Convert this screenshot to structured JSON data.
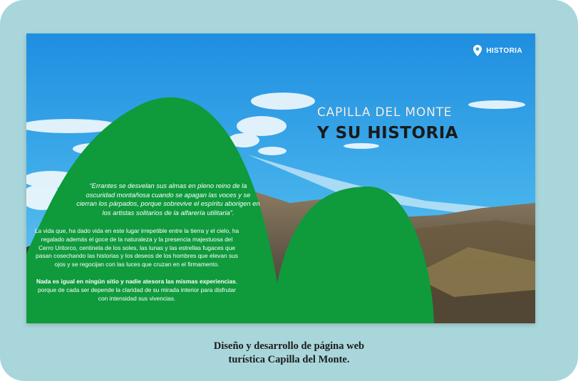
{
  "nav": {
    "label": "HISTORIA",
    "icon": "location-pin-icon"
  },
  "title": {
    "line1": "CAPILLA DEL MONTE",
    "line2": "Y SU HISTORIA"
  },
  "quote": "“Errantes se desvelan sus almas en pleno reino de la oscuridad montañosa cuando se apagan las voces y se cierran los párpados, porque sobrevive el espíritu aborigen en los artistas solitarios de la alfarería utilitaria”.",
  "body": {
    "paragraph": "La vida que, ha dado vida en este lugar irrepetible entre la tierra y el cielo, ha regalado además el goce de la naturaleza y la presencia majestuosa del Cerro Uritorco, centinela de los soles, las lunas y las estrellas fugaces que pasan cosechando las historias y los deseos de los hombres que elevan sus ojos y se regocijan con las luces que cruzan en el firmamento.",
    "bold": "Nada es igual en ningún sitio y nadie atesora las mismas experiencias",
    "closing": ", porque de cada ser depende la claridad de su mirada interior para disfrutar con intensidad sus vivencias."
  },
  "caption": {
    "line1": "Diseño y desarrollo de página web",
    "line2": "turística Capilla del Monte."
  },
  "colors": {
    "frame": "#a9d6db",
    "sky": "#2f9fe2",
    "hill": "#0f9a3c",
    "nav_text": "#ffffff"
  }
}
